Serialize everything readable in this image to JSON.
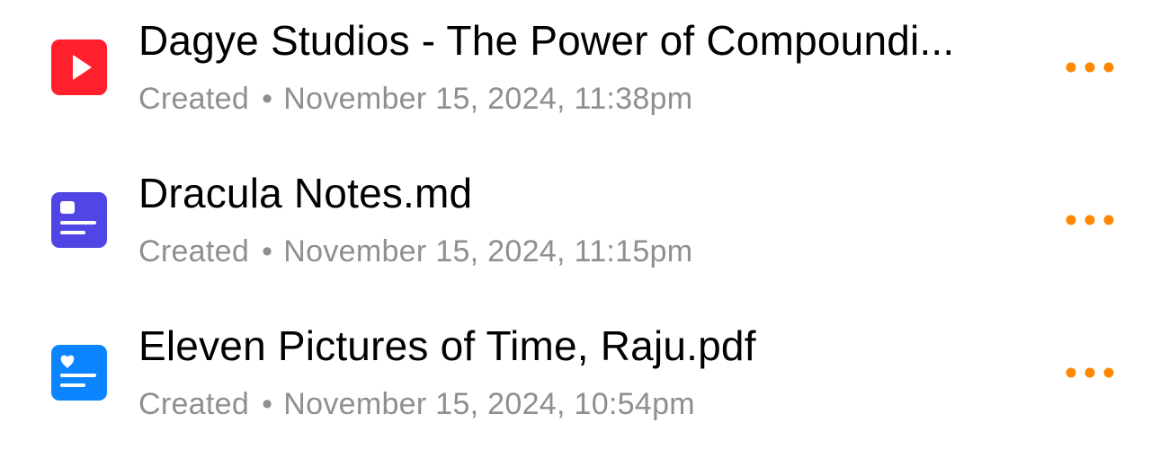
{
  "accent_color": "#ff8800",
  "items": [
    {
      "icon": "video-icon",
      "icon_color": "#ff1f2d",
      "title": "Dagye Studios - The Power of Compoundi...",
      "meta_label": "Created",
      "separator": "•",
      "date": "November 15, 2024, 11:38pm"
    },
    {
      "icon": "note-document-icon",
      "icon_color": "#4f46e5",
      "title": "Dracula Notes.md",
      "meta_label": "Created",
      "separator": "•",
      "date": "November 15, 2024, 11:15pm"
    },
    {
      "icon": "pdf-document-icon",
      "icon_color": "#0a84ff",
      "title": "Eleven Pictures of Time, Raju.pdf",
      "meta_label": "Created",
      "separator": "•",
      "date": "November 15, 2024, 10:54pm"
    }
  ]
}
